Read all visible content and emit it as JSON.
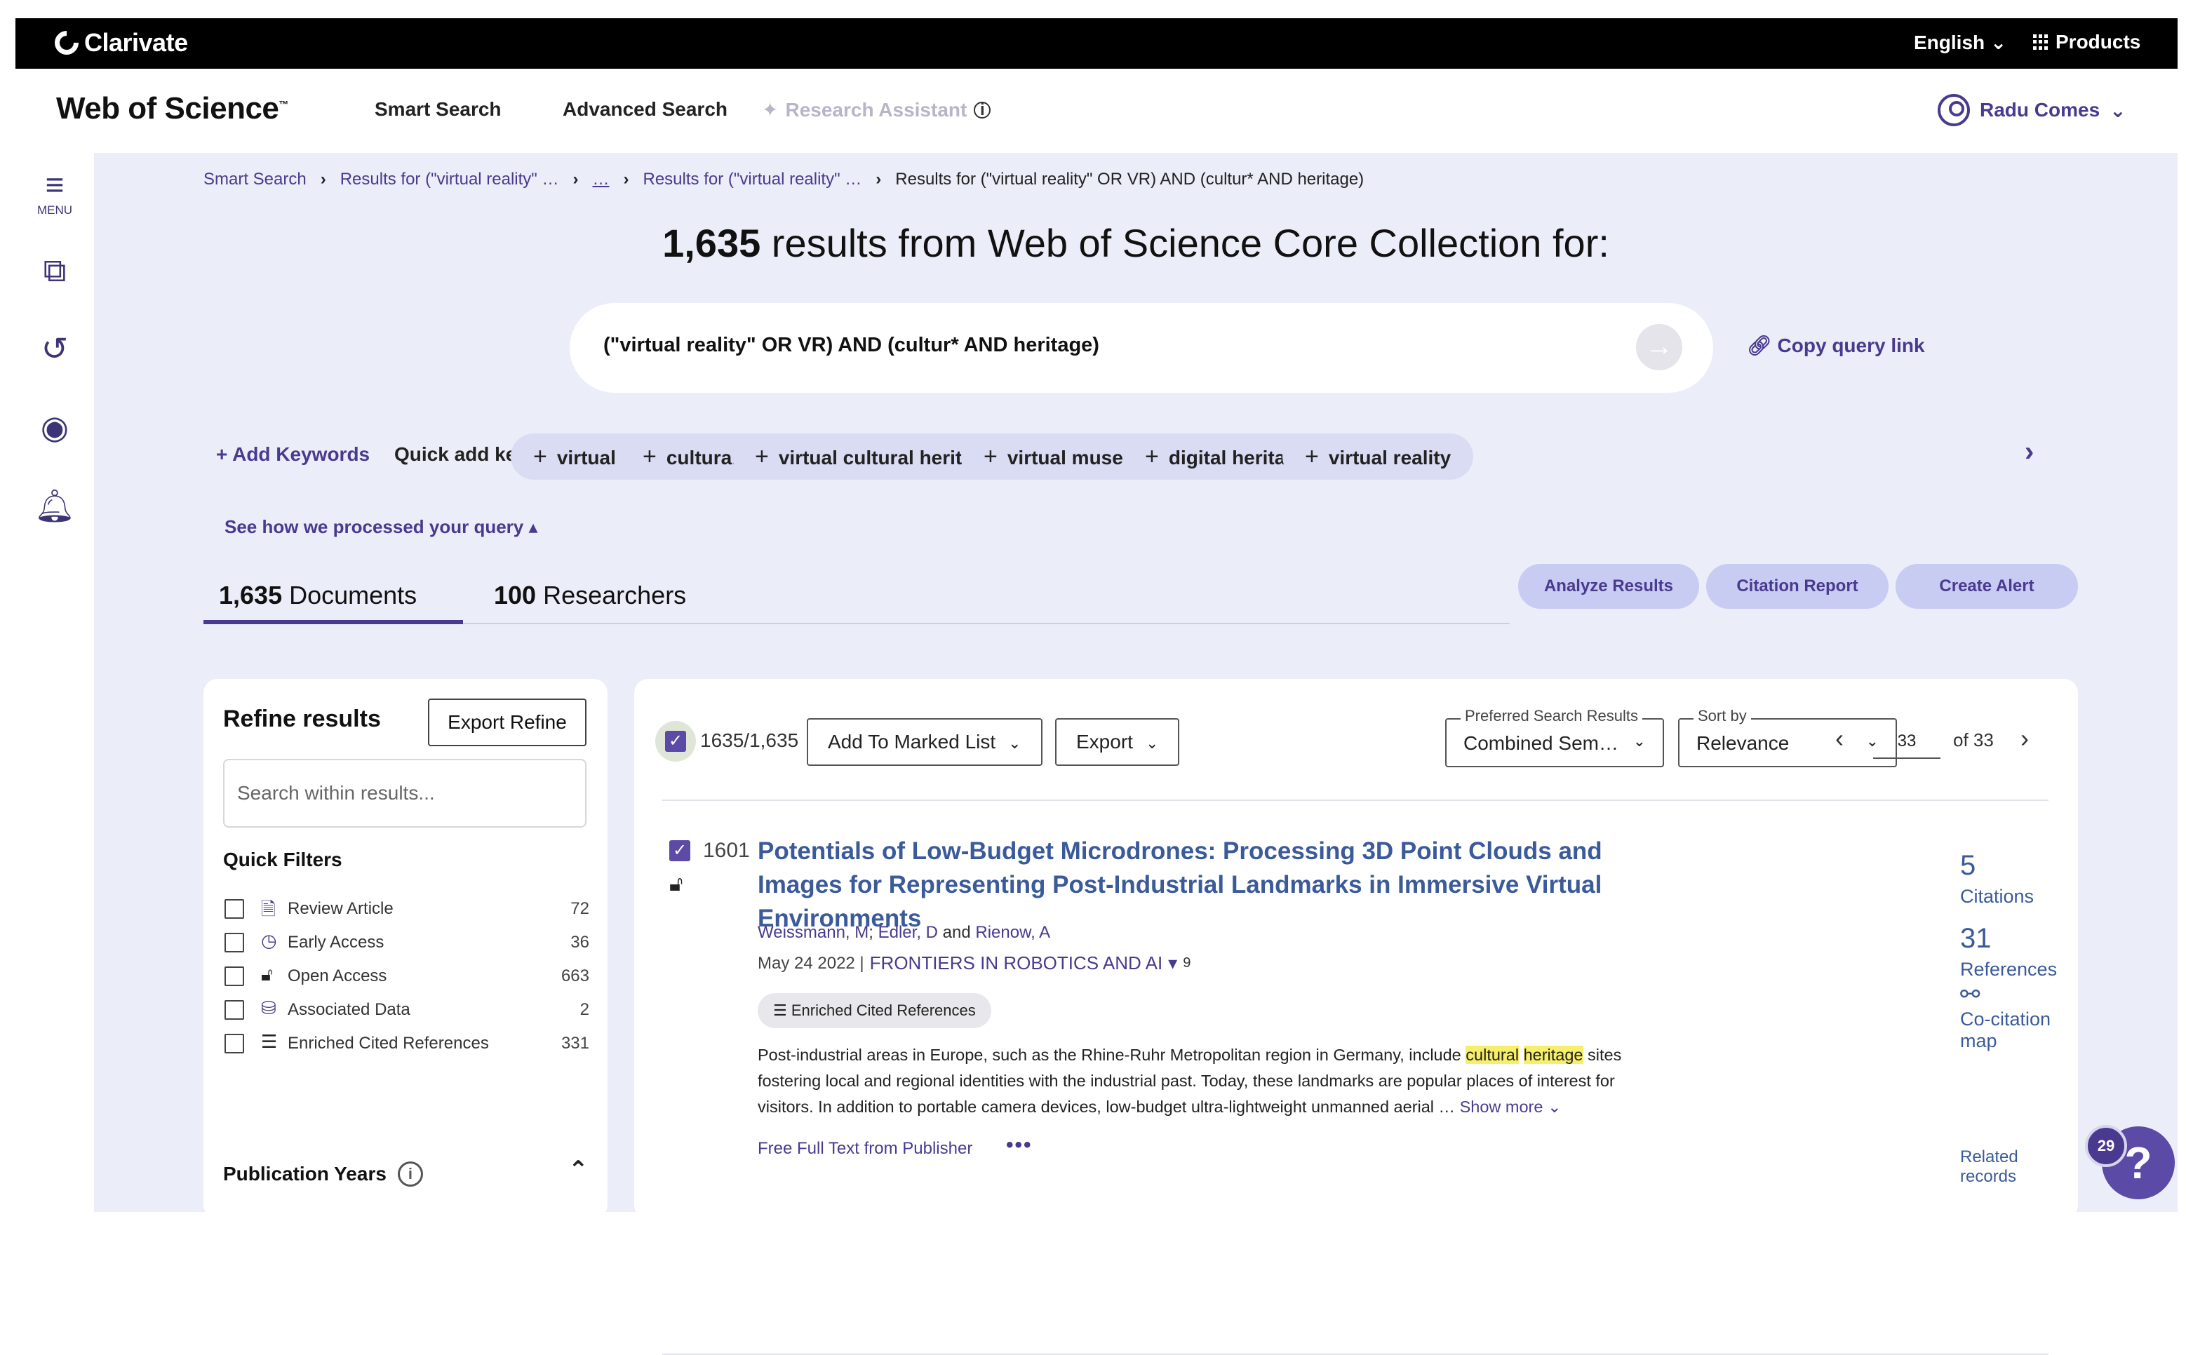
{
  "topbar": {
    "brand": "Clarivate",
    "language": "English",
    "products": "Products"
  },
  "navbar": {
    "product": "Web of Science",
    "trademark": "™",
    "smart_search": "Smart Search",
    "advanced_search": "Advanced Search",
    "research_assistant": "Research Assistant",
    "user_name": "Radu Comes"
  },
  "rail": {
    "menu_label": "MENU"
  },
  "breadcrumbs": [
    "Smart Search",
    "Results for (\"virtual reality\" …",
    "…",
    "Results for (\"virtual reality\" …",
    "Results for (\"virtual reality\" OR VR) AND (cultur* AND heritage)"
  ],
  "headline": {
    "count": "1,635",
    "text": " results from Web of Science Core Collection for:"
  },
  "query": {
    "text": "(\"virtual reality\" OR VR) AND (cultur* AND heritage)",
    "copy_link": "Copy query link"
  },
  "keywords": {
    "add_label": "Add Keywords",
    "quick_label": "Quick add keywords:",
    "chips": [
      "virtual heritage",
      "cultural heritage",
      "virtual cultural heritage",
      "virtual museum",
      "digital heritage",
      "virtual reality"
    ]
  },
  "processed_link": "See how we processed your query",
  "tabs": [
    {
      "count": "1,635",
      "label": "Documents"
    },
    {
      "count": "100",
      "label": "Researchers"
    }
  ],
  "actions": {
    "analyze": "Analyze Results",
    "citation": "Citation Report",
    "alert": "Create Alert"
  },
  "refine": {
    "title": "Refine results",
    "export": "Export Refine",
    "search_placeholder": "Search within results...",
    "quick_filters_title": "Quick Filters",
    "quick_filters": [
      {
        "label": "Review Article",
        "count": "72",
        "icon": "document-icon"
      },
      {
        "label": "Early Access",
        "count": "36",
        "icon": "clock-icon"
      },
      {
        "label": "Open Access",
        "count": "663",
        "icon": "unlock-icon"
      },
      {
        "label": "Associated Data",
        "count": "2",
        "icon": "database-icon"
      },
      {
        "label": "Enriched Cited References",
        "count": "331",
        "icon": "enriched-list-icon"
      }
    ],
    "pub_years": "Publication Years"
  },
  "toolbar": {
    "selected": "1635/1,635",
    "add_marked": "Add To Marked List",
    "export": "Export",
    "pref_label": "Preferred Search Results",
    "pref_value": "Combined Sem…",
    "sort_label": "Sort by",
    "sort_value": "Relevance",
    "page": "33",
    "of_pages": "of 33"
  },
  "record": {
    "number": "1601",
    "title": "Potentials of Low-Budget Microdrones: Processing 3D Point Clouds and Images for Representing Post-Industrial Landmarks in Immersive Virtual Environments",
    "authors": [
      "Weissmann, M",
      "Edler, D",
      "Rienow, A"
    ],
    "author_sep": ";",
    "and": "and",
    "date": "May 24 2022 |",
    "journal": "FRONTIERS IN ROBOTICS AND AI",
    "volume": "9",
    "badge": "Enriched Cited References",
    "abstract_a": "Post-industrial areas in Europe, such as the Rhine-Ruhr Metropolitan region in Germany, include ",
    "abstract_hl1": "cultural",
    "abstract_hl2": "heritage",
    "abstract_b": " sites fostering local and regional identities with the industrial past. Today, these landmarks are popular places of interest for visitors. In addition to portable camera devices, low-budget ultra-lightweight unmanned aerial … ",
    "show_more": "Show more",
    "free_text": "Free Full Text from Publisher",
    "more_dots": "•••",
    "citations": "5",
    "citations_label": "Citations",
    "references": "31",
    "references_label": "References",
    "cocitation": "Co-citation map",
    "related": "Related records"
  },
  "help": {
    "badge": "29",
    "symbol": "?"
  },
  "colors": {
    "accent": "#4a3a8f",
    "background": "#ebedf8",
    "chip": "#dadcf4",
    "link": "#3a5a9a"
  }
}
